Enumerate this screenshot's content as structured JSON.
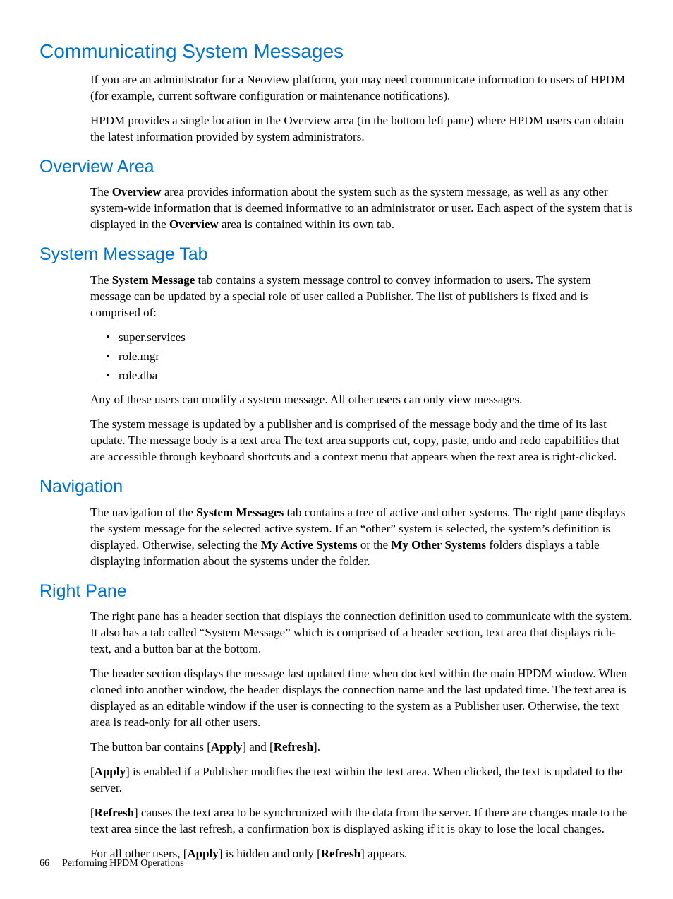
{
  "h_comm": "Communicating System Messages",
  "p_comm_1": "If you are an administrator for a Neoview platform, you may need communicate information to users of HPDM (for example, current software configuration or maintenance notifications).",
  "p_comm_2": "HPDM provides a single location in the Overview area (in the bottom left pane) where HPDM users can obtain the latest information provided by system administrators.",
  "h_ov": "Overview Area",
  "p_ov_pre": "The ",
  "p_ov_b1": "Overview",
  "p_ov_mid": " area provides information about the system such as the system message, as well as any other system-wide information that is deemed informative to an administrator or user. Each aspect of the system that is displayed in the ",
  "p_ov_b2": "Overview",
  "p_ov_post": " area is contained within its own tab.",
  "h_smt": "System Message Tab",
  "p_smt_pre": "The ",
  "p_smt_b1": "System Message",
  "p_smt_post": " tab contains a system message control to convey information to users. The system message can be updated by a special role of user called a Publisher. The list of publishers is fixed and is comprised of:",
  "li_1": "super.services",
  "li_2": "role.mgr",
  "li_3": "role.dba",
  "p_smt_2": "Any of these users can modify a system message. All other users can only view messages.",
  "p_smt_3": "The system message is updated by a publisher and is comprised of the message body and the time of its last update. The message body is a text area The text area supports cut, copy, paste, undo and redo capabilities that are accessible through keyboard shortcuts and a context menu that appears when the text area is right-clicked.",
  "h_nav": "Navigation",
  "p_nav_pre": "The navigation of the ",
  "p_nav_b1": "System Messages",
  "p_nav_mid1": " tab contains a tree of active and other systems. The right pane displays the system message for the selected active system. If an “other” system is selected, the system’s definition is displayed. Otherwise, selecting the ",
  "p_nav_b2": "My Active Systems",
  "p_nav_mid2": " or the ",
  "p_nav_b3": "My Other Systems",
  "p_nav_post": " folders displays a table displaying information about the systems under the folder.",
  "h_rp": "Right Pane",
  "p_rp_1": "The right pane has a header section that displays the connection definition used to communicate with the system. It also has a tab called “System Message” which is comprised of a header section, text area that displays rich-text, and a button bar at the bottom.",
  "p_rp_2": "The header section displays the message last updated time when docked within the main HPDM window. When cloned into another window, the header displays the connection name and the last updated time. The text area is displayed as an editable window if the user is connecting to the system as a Publisher user. Otherwise, the text area is read-only for all other users.",
  "p_rp_3_pre": "The button bar contains [",
  "p_rp_3_b1": "Apply",
  "p_rp_3_mid": "] and [",
  "p_rp_3_b2": "Refresh",
  "p_rp_3_post": "].",
  "p_rp_4_pre": "[",
  "p_rp_4_b1": "Apply",
  "p_rp_4_post": "] is enabled if a Publisher modifies the text within the text area. When clicked, the text is updated to the server.",
  "p_rp_5_pre": "[",
  "p_rp_5_b1": "Refresh",
  "p_rp_5_post": "] causes the text area to be synchronized with the data from the server. If there are changes made to the text area since the last refresh, a confirmation box is displayed asking if it is okay to lose the local changes.",
  "p_rp_6_pre": "For all other users, [",
  "p_rp_6_b1": "Apply",
  "p_rp_6_mid": "] is hidden and only [",
  "p_rp_6_b2": "Refresh",
  "p_rp_6_post": "] appears.",
  "footer_page": "66",
  "footer_title": "Performing HPDM Operations"
}
